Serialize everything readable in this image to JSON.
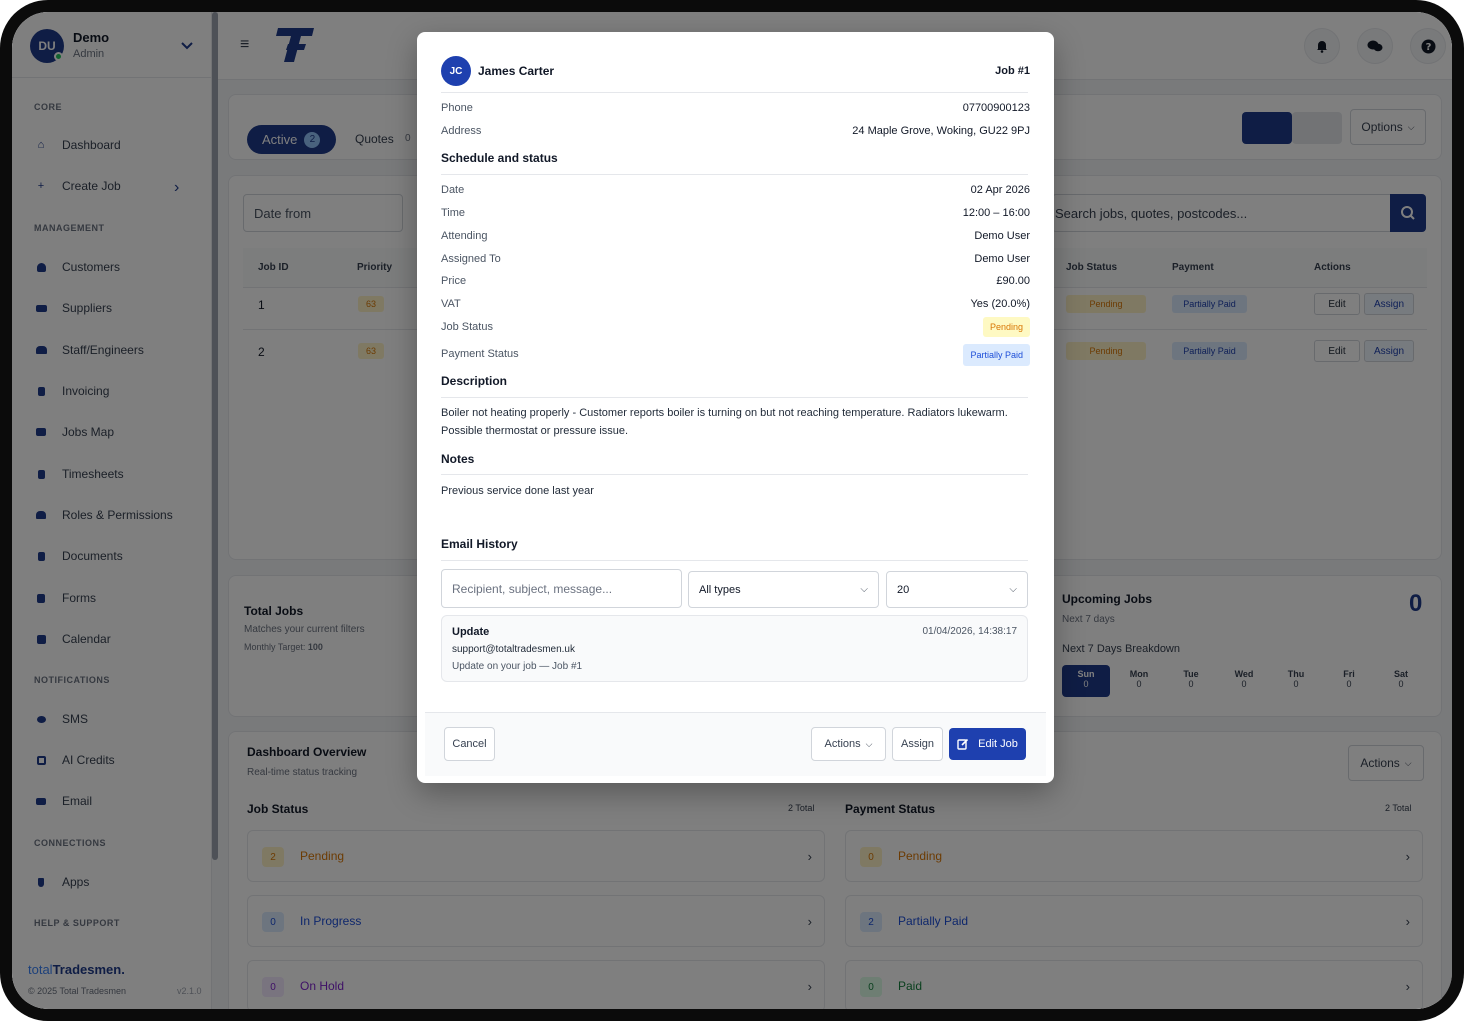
{
  "user": {
    "initials": "DU",
    "name": "Demo",
    "role": "Admin"
  },
  "sidebar": {
    "sections": {
      "core": "CORE",
      "management": "MANAGEMENT",
      "notifications": "NOTIFICATIONS",
      "connections": "CONNECTIONS",
      "help": "HELP & SUPPORT"
    },
    "items": {
      "dashboard": "Dashboard",
      "create_job": "Create Job",
      "customers": "Customers",
      "suppliers": "Suppliers",
      "staff": "Staff/Engineers",
      "invoicing": "Invoicing",
      "jobs_map": "Jobs Map",
      "timesheets": "Timesheets",
      "roles": "Roles & Permissions",
      "documents": "Documents",
      "forms": "Forms",
      "calendar": "Calendar",
      "sms": "SMS",
      "ai_credits": "AI Credits",
      "email": "Email",
      "apps": "Apps"
    },
    "brand_light": "total",
    "brand_bold": "Tradesmen.",
    "copyright": "© 2025 Total Tradesmen",
    "version": "v2.1.0"
  },
  "jobs": {
    "tab_active": "Active",
    "tab_active_count": "2",
    "tab_quotes": "Quotes",
    "tab_quotes_count": "0",
    "options": "Options",
    "date_from": "Date from",
    "search_placeholder": "Search jobs, quotes, postcodes...",
    "columns": {
      "job_id": "Job ID",
      "priority": "Priority",
      "job_status": "Job Status",
      "payment": "Payment",
      "actions": "Actions"
    },
    "rows": [
      {
        "id": "1",
        "priority": "63",
        "status": "Pending",
        "payment": "Partially Paid",
        "edit": "Edit",
        "assign": "Assign"
      },
      {
        "id": "2",
        "priority": "63",
        "status": "Pending",
        "payment": "Partially Paid",
        "edit": "Edit",
        "assign": "Assign"
      }
    ]
  },
  "stats": {
    "total_jobs": "Total Jobs",
    "total_sub": "Matches your current filters",
    "target_label": "Monthly Target:",
    "target_value": "100",
    "upcoming": "Upcoming Jobs",
    "upcoming_sub": "Next 7 days",
    "upcoming_count": "0",
    "breakdown": "Next 7 Days Breakdown",
    "days": [
      {
        "d": "Sun",
        "n": "0"
      },
      {
        "d": "Mon",
        "n": "0"
      },
      {
        "d": "Tue",
        "n": "0"
      },
      {
        "d": "Wed",
        "n": "0"
      },
      {
        "d": "Thu",
        "n": "0"
      },
      {
        "d": "Fri",
        "n": "0"
      },
      {
        "d": "Sat",
        "n": "0"
      }
    ]
  },
  "overview": {
    "title": "Dashboard Overview",
    "subtitle": "Real-time status tracking",
    "actions": "Actions",
    "job_status": "Job Status",
    "job_total": "2 Total",
    "payment_status": "Payment Status",
    "payment_total": "2 Total",
    "job_cards": [
      {
        "n": "2",
        "label": "Pending"
      },
      {
        "n": "0",
        "label": "In Progress"
      },
      {
        "n": "0",
        "label": "On Hold"
      }
    ],
    "payment_cards": [
      {
        "n": "0",
        "label": "Pending"
      },
      {
        "n": "2",
        "label": "Partially Paid"
      },
      {
        "n": "0",
        "label": "Paid"
      }
    ]
  },
  "modal": {
    "initials": "JC",
    "customer": "James Carter",
    "job_id": "Job #1",
    "phone_label": "Phone",
    "phone": "07700900123",
    "address_label": "Address",
    "address": "24 Maple Grove, Woking, GU22 9PJ",
    "schedule_heading": "Schedule and status",
    "date_label": "Date",
    "date": "02 Apr 2026",
    "time_label": "Time",
    "time": "12:00 – 16:00",
    "attending_label": "Attending",
    "attending": "Demo User",
    "assigned_label": "Assigned To",
    "assigned": "Demo User",
    "price_label": "Price",
    "price": "£90.00",
    "vat_label": "VAT",
    "vat": "Yes (20.0%)",
    "job_status_label": "Job Status",
    "job_status": "Pending",
    "payment_status_label": "Payment Status",
    "payment_status": "Partially Paid",
    "description_heading": "Description",
    "description": "Boiler not heating properly - Customer reports boiler is turning on but not reaching temperature. Radiators lukewarm. Possible thermostat or pressure issue.",
    "notes_heading": "Notes",
    "notes": "Previous service done last year",
    "email_heading": "Email History",
    "email_search_placeholder": "Recipient, subject, message...",
    "email_type_filter": "All types",
    "email_page_size": "20",
    "email": {
      "type": "Update",
      "time": "01/04/2026, 14:38:17",
      "to": "support@totaltradesmen.uk",
      "subject": "Update on your job — Job #1"
    },
    "cancel": "Cancel",
    "actions": "Actions",
    "assign": "Assign",
    "edit": "Edit Job"
  },
  "colors": {
    "primary": "#1e3a8a",
    "pending": "#d97706",
    "partially_paid": "#1d4ed8"
  }
}
